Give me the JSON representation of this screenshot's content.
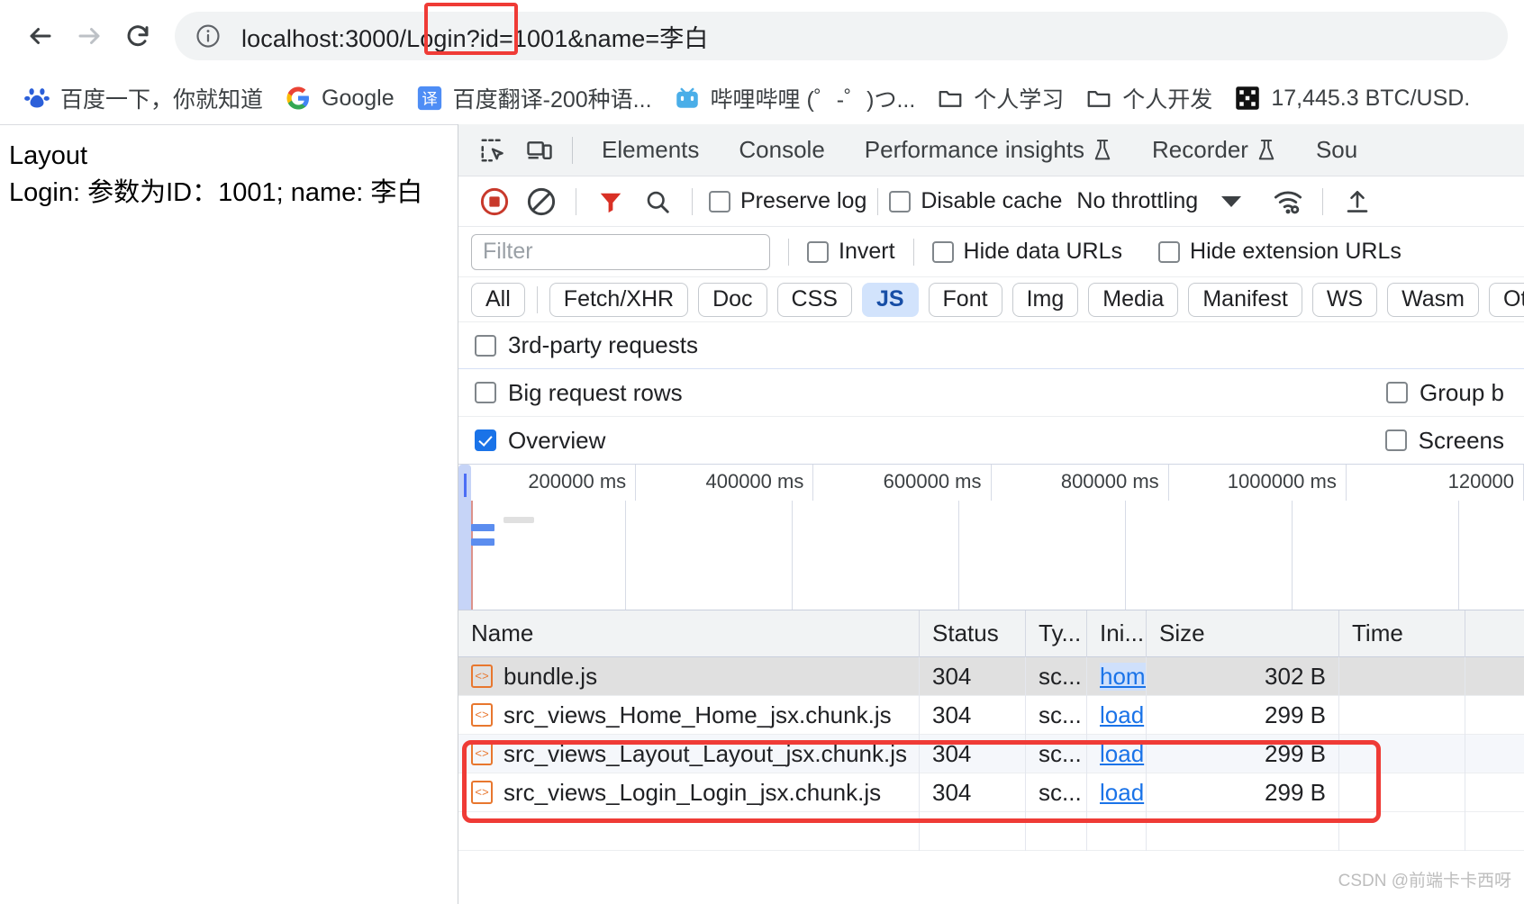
{
  "browser": {
    "back_label": "Back",
    "forward_label": "Forward",
    "reload_label": "Reload",
    "site_info_label": "View site information",
    "url": "localhost:3000/Login?id=1001&name=李白",
    "url_annotation": "/Login?"
  },
  "bookmarks": [
    {
      "icon": "baidu-icon",
      "label": "百度一下，你就知道"
    },
    {
      "icon": "google-icon",
      "label": "Google"
    },
    {
      "icon": "fanyi-icon",
      "label": "百度翻译-200种语..."
    },
    {
      "icon": "bilibili-icon",
      "label": "哔哩哔哩 (゜-゜)つ..."
    },
    {
      "icon": "folder-icon",
      "label": "个人学习"
    },
    {
      "icon": "folder-icon",
      "label": "个人开发"
    },
    {
      "icon": "qrcode-icon",
      "label": "17,445.3 BTC/USD."
    }
  ],
  "viewport": {
    "heading": "Layout",
    "body": "Login: 参数为ID：1001; name: 李白"
  },
  "devtools": {
    "tools": [
      {
        "icon": "inspect-element-icon",
        "label": "Inspect element"
      },
      {
        "icon": "device-toolbar-icon",
        "label": "Toggle device toolbar"
      }
    ],
    "tabs": [
      {
        "label": "Elements",
        "experimental": false,
        "active": false
      },
      {
        "label": "Console",
        "experimental": false,
        "active": false
      },
      {
        "label": "Performance insights",
        "experimental": true,
        "active": false
      },
      {
        "label": "Recorder",
        "experimental": true,
        "active": false
      },
      {
        "label": "Sou",
        "experimental": false,
        "active": false
      }
    ],
    "network_toolbar": {
      "record_label": "Stop recording network log",
      "clear_label": "Clear network log",
      "filter_icon_label": "Filter",
      "search_icon_label": "Search",
      "preserve_log": {
        "label": "Preserve log",
        "checked": false
      },
      "disable_cache": {
        "label": "Disable cache",
        "checked": false
      },
      "throttling": "No throttling",
      "network_conditions_label": "Network conditions",
      "import_har_label": "Import HAR file"
    },
    "filter_bar": {
      "filter_placeholder": "Filter",
      "filter_value": "",
      "invert": {
        "label": "Invert",
        "checked": false
      },
      "hide_data_urls": {
        "label": "Hide data URLs",
        "checked": false
      },
      "hide_extension_urls": {
        "label": "Hide extension URLs",
        "checked": false
      }
    },
    "type_filters": [
      {
        "label": "All",
        "active": false
      },
      {
        "label": "Fetch/XHR",
        "active": false
      },
      {
        "label": "Doc",
        "active": false
      },
      {
        "label": "CSS",
        "active": false
      },
      {
        "label": "JS",
        "active": true
      },
      {
        "label": "Font",
        "active": false
      },
      {
        "label": "Img",
        "active": false
      },
      {
        "label": "Media",
        "active": false
      },
      {
        "label": "Manifest",
        "active": false
      },
      {
        "label": "WS",
        "active": false
      },
      {
        "label": "Wasm",
        "active": false
      },
      {
        "label": "Other",
        "active": false
      }
    ],
    "options": {
      "third_party": {
        "label": "3rd-party requests",
        "checked": false
      },
      "big_rows": {
        "label": "Big request rows",
        "checked": false
      },
      "group_by": {
        "label": "Group b",
        "checked": false
      },
      "overview": {
        "label": "Overview",
        "checked": true
      },
      "screenshots": {
        "label": "Screens",
        "checked": false
      }
    },
    "overview_ticks": [
      "200000 ms",
      "400000 ms",
      "600000 ms",
      "800000 ms",
      "1000000 ms",
      "120000"
    ],
    "table": {
      "columns": [
        "Name",
        "Status",
        "Ty...",
        "Ini...",
        "Size",
        "Time",
        ""
      ],
      "rows": [
        {
          "name": "bundle.js",
          "status": "304",
          "type": "sc...",
          "initiator": "home",
          "initiator_selected": true,
          "size": "302 B",
          "time": "",
          "selected": true
        },
        {
          "name": "src_views_Home_Home_jsx.chunk.js",
          "status": "304",
          "type": "sc...",
          "initiator": "load",
          "initiator_selected": false,
          "size": "299 B",
          "time": "",
          "selected": false
        },
        {
          "name": "src_views_Layout_Layout_jsx.chunk.js",
          "status": "304",
          "type": "sc...",
          "initiator": "load",
          "initiator_selected": false,
          "size": "299 B",
          "time": "",
          "selected": false
        },
        {
          "name": "src_views_Login_Login_jsx.chunk.js",
          "status": "304",
          "type": "sc...",
          "initiator": "load",
          "initiator_selected": false,
          "size": "299 B",
          "time": "",
          "selected": false
        }
      ]
    }
  },
  "watermark": "CSDN @前端卡卡西呀",
  "colors": {
    "accent": "#1a73e8",
    "annotation_red": "#ef3b36",
    "record_red": "#c8392b",
    "js_icon_orange": "#e8772e",
    "devtools_tabbar": "#f1f3f4"
  }
}
